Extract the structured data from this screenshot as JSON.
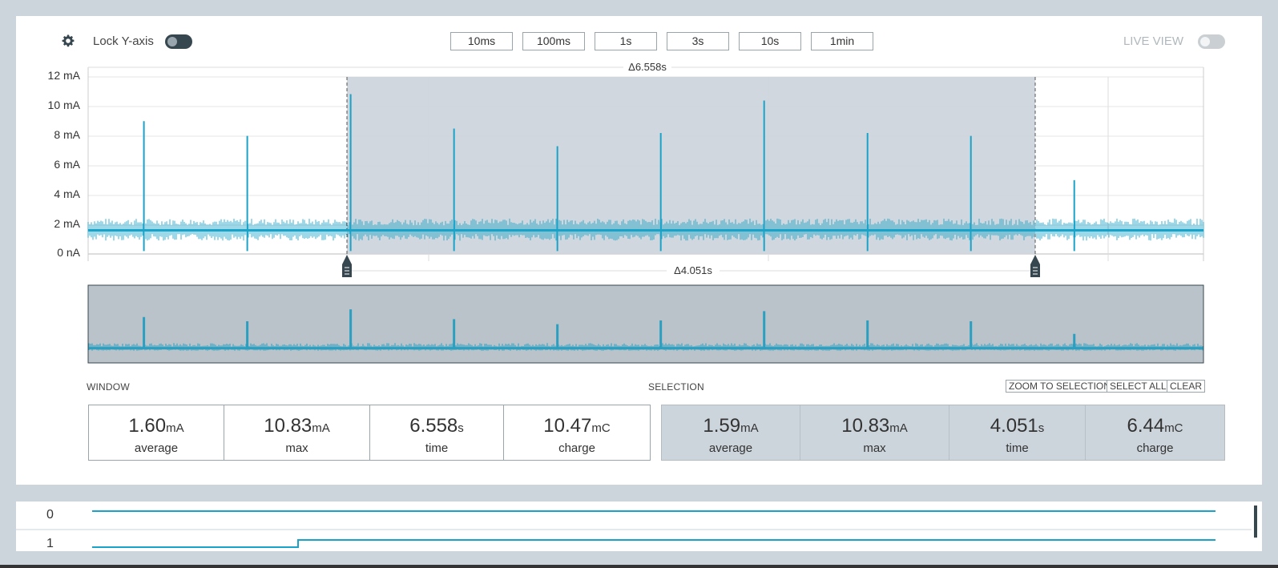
{
  "toolbar": {
    "lock_label": "Lock Y-axis",
    "lock_on": true,
    "zoom_buttons": [
      "10ms",
      "100ms",
      "1s",
      "3s",
      "10s",
      "1min"
    ],
    "live_label": "LIVE VIEW",
    "live_on": false
  },
  "chart_data": {
    "type": "line",
    "ylabel": "",
    "y_ticks": [
      "12 mA",
      "10 mA",
      "8 mA",
      "6 mA",
      "4 mA",
      "2 mA",
      "0 nA"
    ],
    "ylim": [
      0,
      12
    ],
    "baseline_mA": 1.6,
    "series": [
      {
        "values": [
          {
            "x": 0.41,
            "y": 9.0
          },
          {
            "x": 1.17,
            "y": 8.0
          },
          {
            "x": 1.93,
            "y": 10.83
          },
          {
            "x": 2.69,
            "y": 8.5
          },
          {
            "x": 3.45,
            "y": 7.3
          },
          {
            "x": 4.21,
            "y": 8.2
          },
          {
            "x": 4.97,
            "y": 10.4
          },
          {
            "x": 5.73,
            "y": 8.2
          },
          {
            "x": 6.49,
            "y": 8.0
          },
          {
            "x": 7.25,
            "y": 5.0
          }
        ]
      }
    ],
    "window_delta": "Δ6.558s",
    "selection_delta": "Δ4.051s",
    "accent": "#1aa3c8",
    "selection_shade": "#cdd5dc"
  },
  "window": {
    "label": "WINDOW",
    "stats": [
      {
        "value": "1.60",
        "unit": "mA",
        "name": "average"
      },
      {
        "value": "10.83",
        "unit": "mA",
        "name": "max"
      },
      {
        "value": "6.558",
        "unit": "s",
        "name": "time"
      },
      {
        "value": "10.47",
        "unit": "mC",
        "name": "charge"
      }
    ]
  },
  "selection": {
    "label": "SELECTION",
    "buttons": [
      "ZOOM TO SELECTION",
      "SELECT ALL",
      "CLEAR"
    ],
    "stats": [
      {
        "value": "1.59",
        "unit": "mA",
        "name": "average"
      },
      {
        "value": "10.83",
        "unit": "mA",
        "name": "max"
      },
      {
        "value": "4.051",
        "unit": "s",
        "name": "time"
      },
      {
        "value": "6.44",
        "unit": "mC",
        "name": "charge"
      }
    ]
  },
  "digital_channels": [
    {
      "label": "0"
    },
    {
      "label": "1"
    }
  ]
}
